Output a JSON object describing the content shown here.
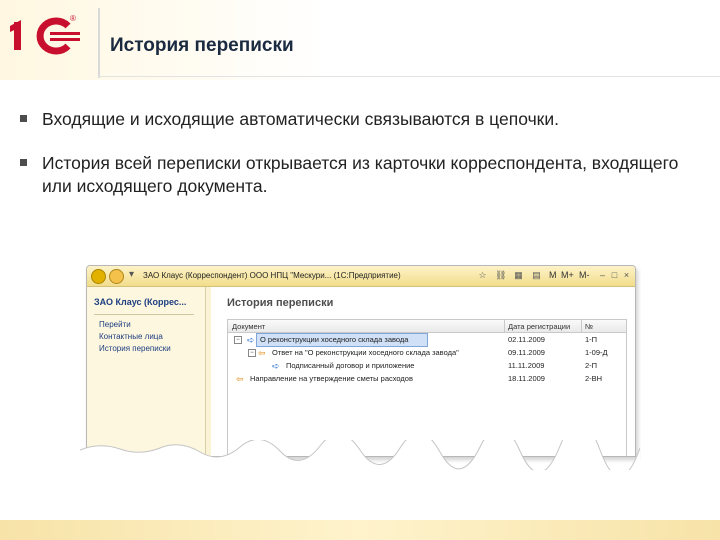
{
  "slide": {
    "title": "История переписки",
    "bullets": [
      "Входящие и исходящие автоматически связываются в цепочки.",
      "История всей переписки открывается из карточки корреспондента, входящего или исходящего документа."
    ],
    "logo_text": "1С",
    "logo_reg": "®"
  },
  "window": {
    "title": "ЗАО Клаус (Корреспондент) ООО НПЦ \"Мескури... (1С:Предприятие)",
    "toolbar_labels": [
      "M",
      "M+",
      "M-"
    ],
    "left_panel": {
      "title": "ЗАО Клаус (Коррес...",
      "items": [
        "Перейти",
        "Контактные лица",
        "История переписки"
      ]
    },
    "right_panel": {
      "title": "История переписки",
      "columns": [
        "Документ",
        "Дата регистрации",
        "№"
      ],
      "rows": [
        {
          "doc": "О реконструкции хоседного склада завода",
          "date": "02.11.2009",
          "num": "1-П",
          "level": 0,
          "dir": "in",
          "selected": true
        },
        {
          "doc": "Ответ на \"О реконструкции хоседного склада завода\"",
          "date": "09.11.2009",
          "num": "1-09-Д",
          "level": 1,
          "dir": "out",
          "selected": false
        },
        {
          "doc": "Подписанный договор и приложение",
          "date": "11.11.2009",
          "num": "2-П",
          "level": 2,
          "dir": "in",
          "selected": false
        },
        {
          "doc": "Направление на утверждение сметы расходов",
          "date": "18.11.2009",
          "num": "2-ВН",
          "level": 0,
          "dir": "out",
          "selected": false
        }
      ]
    }
  },
  "colors": {
    "logo_red": "#c8102e",
    "title_dark": "#1a2a40",
    "link_blue": "#1d3e80",
    "window_bg": "#fbf3d6",
    "selection": "#cfe0f7"
  }
}
